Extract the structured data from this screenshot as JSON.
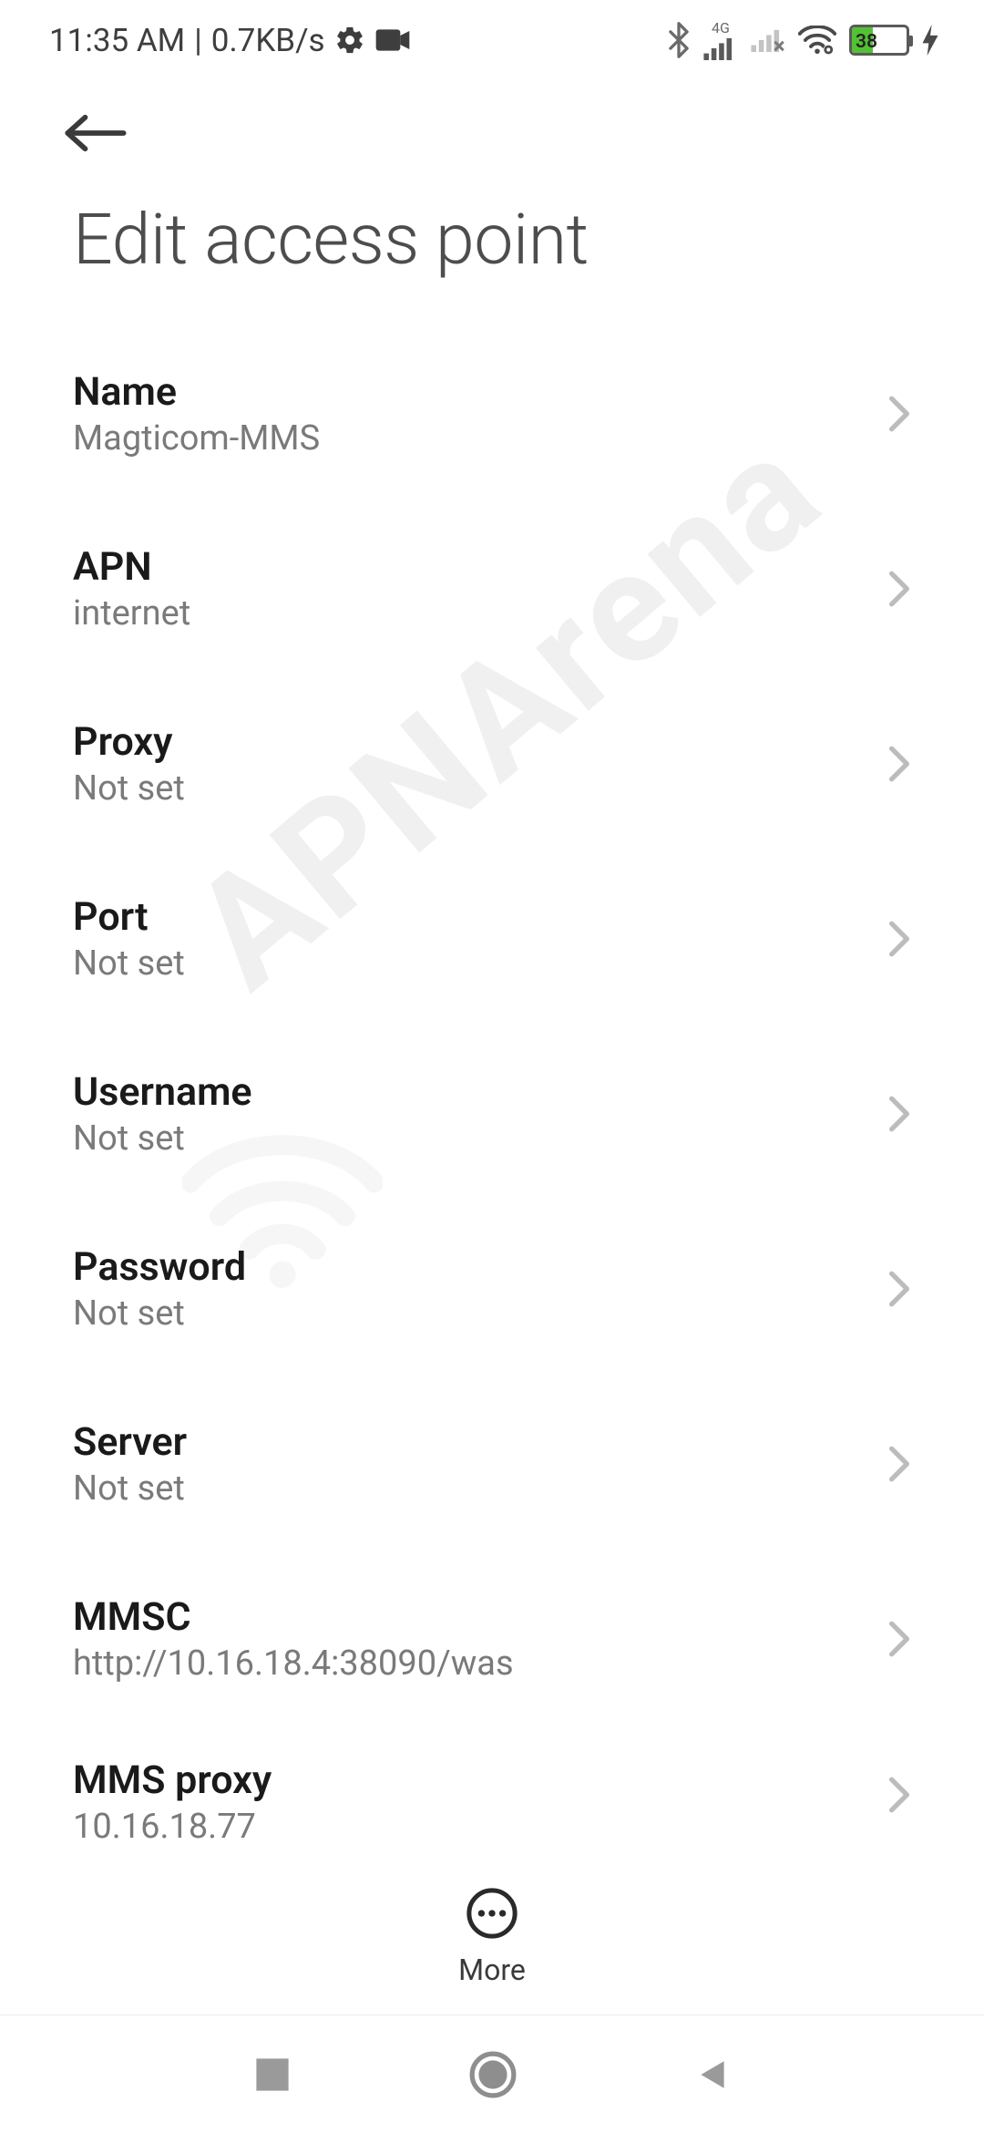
{
  "status": {
    "time": "11:35 AM",
    "separator": "|",
    "speed": "0.7KB/s",
    "battery_pct": "38",
    "network_label": "4G"
  },
  "page": {
    "title": "Edit access point"
  },
  "items": [
    {
      "label": "Name",
      "value": "Magticom-MMS"
    },
    {
      "label": "APN",
      "value": "internet"
    },
    {
      "label": "Proxy",
      "value": "Not set"
    },
    {
      "label": "Port",
      "value": "Not set"
    },
    {
      "label": "Username",
      "value": "Not set"
    },
    {
      "label": "Password",
      "value": "Not set"
    },
    {
      "label": "Server",
      "value": "Not set"
    },
    {
      "label": "MMSC",
      "value": "http://10.16.18.4:38090/was"
    },
    {
      "label": "MMS proxy",
      "value": "10.16.18.77"
    }
  ],
  "bottom": {
    "more": "More"
  },
  "watermark": {
    "text": "APNArena"
  }
}
